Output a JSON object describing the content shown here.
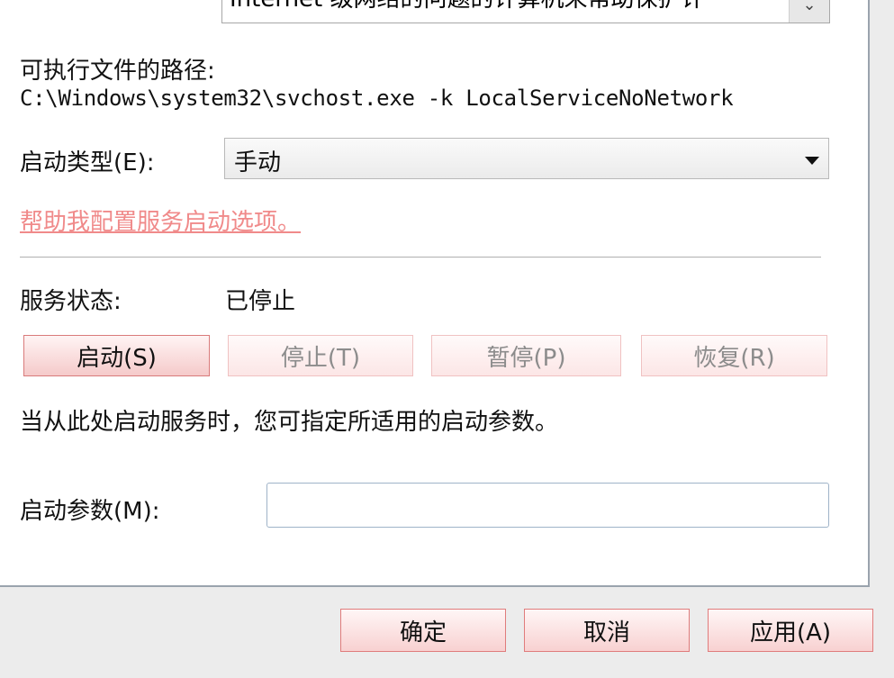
{
  "description": {
    "text": "Internet 级网络的问题的计算机来帮助保护计"
  },
  "path": {
    "label": "可执行文件的路径:",
    "value": "C:\\Windows\\system32\\svchost.exe -k LocalServiceNoNetwork"
  },
  "startup_type": {
    "label": "启动类型(E):",
    "value": "手动"
  },
  "help_link": "帮助我配置服务启动选项。",
  "status": {
    "label": "服务状态:",
    "value": "已停止"
  },
  "service_buttons": {
    "start": "启动(S)",
    "stop": "停止(T)",
    "pause": "暂停(P)",
    "resume": "恢复(R)"
  },
  "hint": "当从此处启动服务时，您可指定所适用的启动参数。",
  "params": {
    "label": "启动参数(M):",
    "value": ""
  },
  "dialog_buttons": {
    "ok": "确定",
    "cancel": "取消",
    "apply": "应用(A)"
  },
  "icons": {
    "scroll": "chevron-down-icon",
    "dropdown": "dropdown-arrow-icon"
  },
  "colors": {
    "link": "#f08a8a",
    "button_border": "#d97b7b",
    "input_border": "#9fb3c8"
  }
}
